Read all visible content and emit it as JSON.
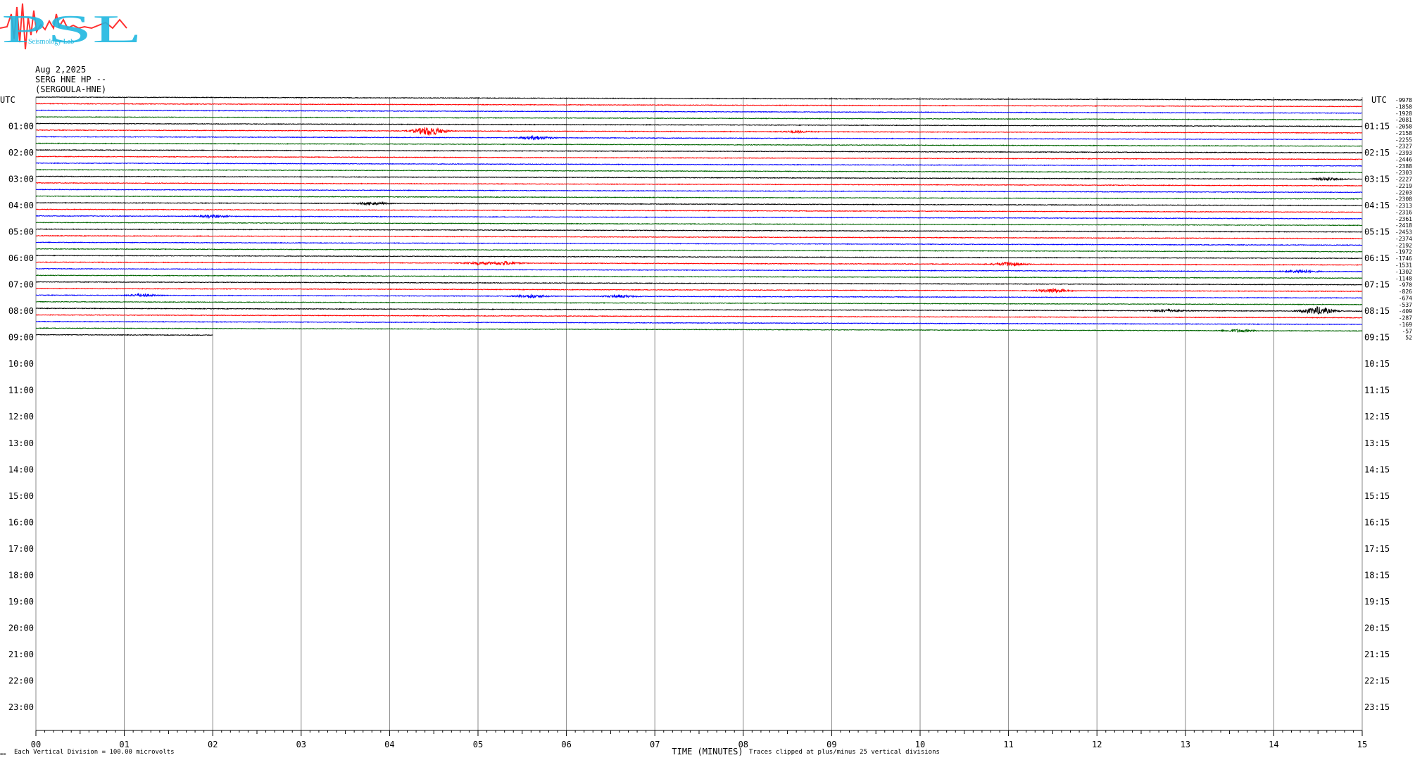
{
  "header": {
    "logo_main": "PSL",
    "logo_sub": "Seismology Lab",
    "date": "Aug 2,2025",
    "station": "SERG HNE HP --",
    "location": "(SERGOULA-HNE)"
  },
  "footer": {
    "left_note": "Each Vertical Division =  100.00 microvolts",
    "clip_note": "Traces clipped at plus/minus 25 vertical divisions",
    "corner_mark": "=="
  },
  "colors": {
    "black": "#000000",
    "red": "#ff0000",
    "blue": "#0000ff",
    "green": "#006400",
    "grid": "#888888",
    "logo_cyan": "#20b8e0",
    "logo_red": "#ff3030"
  },
  "chart_data": {
    "type": "line",
    "title": "",
    "xlabel": "TIME (MINUTES)",
    "ylabel_left": "UTC",
    "ylabel_right": "UTC",
    "x_ticks": [
      "00",
      "01",
      "02",
      "03",
      "04",
      "05",
      "06",
      "07",
      "08",
      "09",
      "10",
      "11",
      "12",
      "13",
      "14",
      "15"
    ],
    "xlim": [
      0,
      15
    ],
    "rows_per_hour": 4,
    "trace_colors": [
      "black",
      "red",
      "blue",
      "green"
    ],
    "left_hours": [
      "01:00",
      "02:00",
      "03:00",
      "04:00",
      "05:00",
      "06:00",
      "07:00",
      "08:00",
      "09:00",
      "10:00",
      "11:00",
      "12:00",
      "13:00",
      "14:00",
      "15:00",
      "16:00",
      "17:00",
      "18:00",
      "19:00",
      "20:00",
      "21:00",
      "22:00",
      "23:00"
    ],
    "right_hours": [
      "01:15",
      "02:15",
      "03:15",
      "04:15",
      "05:15",
      "06:15",
      "07:15",
      "08:15",
      "09:15",
      "10:15",
      "11:15",
      "12:15",
      "13:15",
      "14:15",
      "15:15",
      "16:15",
      "17:15",
      "18:15",
      "19:15",
      "20:15",
      "21:15",
      "22:15",
      "23:15"
    ],
    "row_offsets": [
      "-9978",
      "-1858",
      "-1928",
      "-2081",
      "-2058",
      "-2158",
      "-2255",
      "-2327",
      "-2393",
      "-2446",
      "-2388",
      "-2303",
      "-2227",
      "-2219",
      "-2203",
      "-2308",
      "-2313",
      "-2316",
      "-2361",
      "-2418",
      "-2453",
      "-2374",
      "-2192",
      "-1972",
      "-1746",
      "-1531",
      "-1302",
      "-1148",
      "-970",
      "-826",
      "-674",
      "-537",
      "-409",
      "-287",
      "-169",
      "-57",
      "52"
    ],
    "traces_recorded": 37,
    "last_trace_end_minute": 2.0,
    "events": [
      {
        "row": 5,
        "minute": 4.45,
        "amplitude": 7
      },
      {
        "row": 6,
        "minute": 5.65,
        "amplitude": 3
      },
      {
        "row": 5,
        "minute": 8.6,
        "amplitude": 1.5
      },
      {
        "row": 12,
        "minute": 14.6,
        "amplitude": 2
      },
      {
        "row": 16,
        "minute": 3.8,
        "amplitude": 2
      },
      {
        "row": 18,
        "minute": 2.0,
        "amplitude": 2
      },
      {
        "row": 25,
        "minute": 5.3,
        "amplitude": 2.5
      },
      {
        "row": 25,
        "minute": 5.0,
        "amplitude": 2
      },
      {
        "row": 25,
        "minute": 11.0,
        "amplitude": 3
      },
      {
        "row": 26,
        "minute": 14.3,
        "amplitude": 2.5
      },
      {
        "row": 29,
        "minute": 11.5,
        "amplitude": 3
      },
      {
        "row": 30,
        "minute": 5.6,
        "amplitude": 2.5
      },
      {
        "row": 30,
        "minute": 6.6,
        "amplitude": 2
      },
      {
        "row": 30,
        "minute": 1.2,
        "amplitude": 2
      },
      {
        "row": 32,
        "minute": 14.5,
        "amplitude": 6
      },
      {
        "row": 32,
        "minute": 12.8,
        "amplitude": 2
      },
      {
        "row": 35,
        "minute": 13.6,
        "amplitude": 2
      }
    ]
  }
}
